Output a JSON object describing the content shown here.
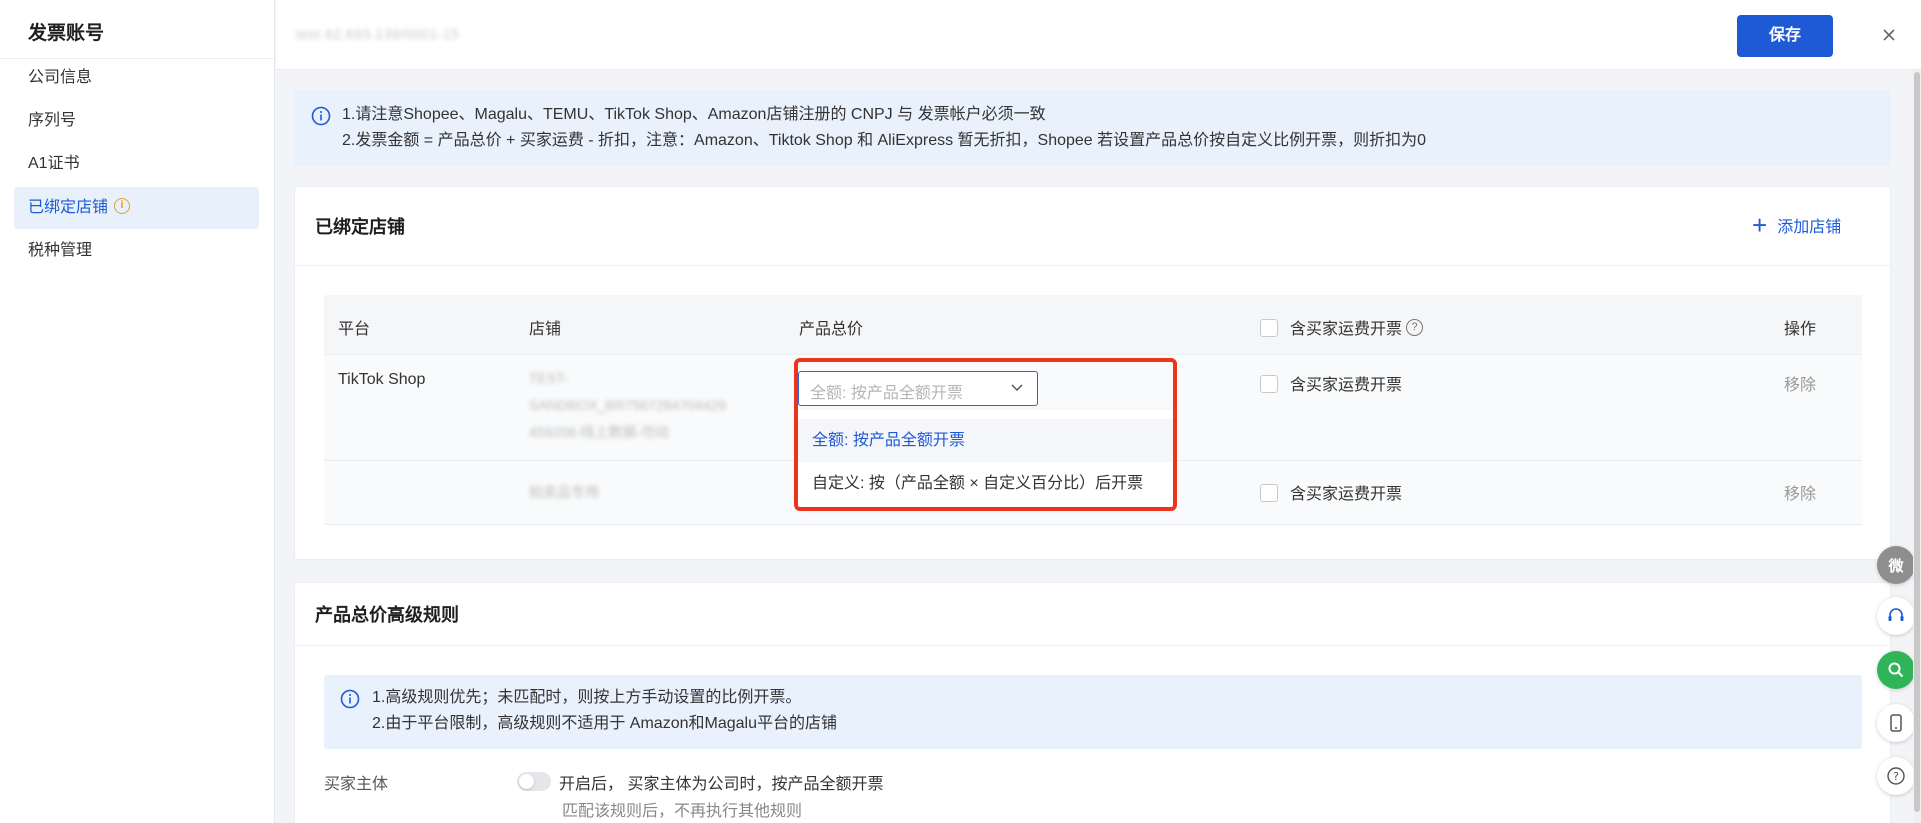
{
  "sidebar": {
    "title": "发票账号",
    "items": [
      {
        "label": "公司信息"
      },
      {
        "label": "序列号"
      },
      {
        "label": "A1证书"
      },
      {
        "label": "已绑定店铺",
        "active": true,
        "badge_icon": "info-icon"
      },
      {
        "label": "税种管理"
      }
    ]
  },
  "header": {
    "blurred_text": "test  62.693.139/0001-15",
    "save_label": "保存",
    "close_icon": "close-icon"
  },
  "notice": {
    "line1": "1.请注意Shopee、Magalu、TEMU、TikTok Shop、Amazon店铺注册的 CNPJ 与 发票帐户必须一致",
    "line2": "2.发票金额 = 产品总价 + 买家运费 - 折扣，注意：Amazon、Tiktok Shop 和 AliExpress 暂无折扣，Shopee 若设置产品总价按自定义比例开票，则折扣为0"
  },
  "bound_stores": {
    "title": "已绑定店铺",
    "add_label": "添加店铺",
    "columns": {
      "platform": "平台",
      "store": "店铺",
      "total_price": "产品总价",
      "shipping": "含买家运费开票",
      "action": "操作"
    },
    "rows": [
      {
        "platform": "TikTok Shop",
        "store_line1": "TEST-",
        "store_line2": "SANDBOX_BR7567284704429",
        "store_line3": "459208-线上数据-勿动",
        "select_placeholder": "全额: 按产品全额开票",
        "shipping_label": "含买家运费开票",
        "action": "移除"
      },
      {
        "platform": "",
        "store_line1": "拍卖品专用",
        "shipping_label": "含买家运费开票",
        "action": "移除"
      }
    ],
    "dropdown_options": [
      {
        "label": "全额: 按产品全额开票",
        "selected": true
      },
      {
        "label": "自定义: 按（产品全额 × 自定义百分比）后开票",
        "selected": false
      }
    ]
  },
  "advanced_rules": {
    "title": "产品总价高级规则",
    "notice_line1": "1.高级规则优先；未匹配时，则按上方手动设置的比例开票。",
    "notice_line2": "2.由于平台限制，高级规则不适用于 Amazon和Magalu平台的店铺",
    "buyer_label": "买家主体",
    "toggle_on": false,
    "toggle_text": "开启后， 买家主体为公司时，按产品全额开票",
    "toggle_sub": "匹配该规则后，不再执行其他规则"
  },
  "floating": {
    "wechat_label": "微",
    "icons": [
      "wechat-icon",
      "headset-icon",
      "search-icon",
      "phone-icon",
      "help-icon"
    ]
  },
  "colors": {
    "primary": "#1f5ad6",
    "highlight": "#e8351c",
    "notice_bg": "#e8f1fc",
    "green": "#2fb457"
  }
}
